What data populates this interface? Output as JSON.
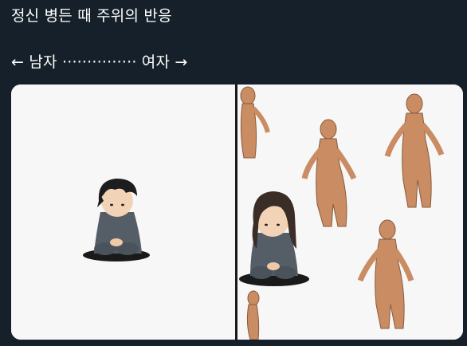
{
  "tweet": {
    "line1": "정신 병든 때 주위의 반응",
    "line2": "← 남자 ··············· 여자 →"
  },
  "colors": {
    "background": "#15202b",
    "text": "#ffffff",
    "panel_background": "#f5f5f5",
    "divider": "#1a1a1a"
  }
}
